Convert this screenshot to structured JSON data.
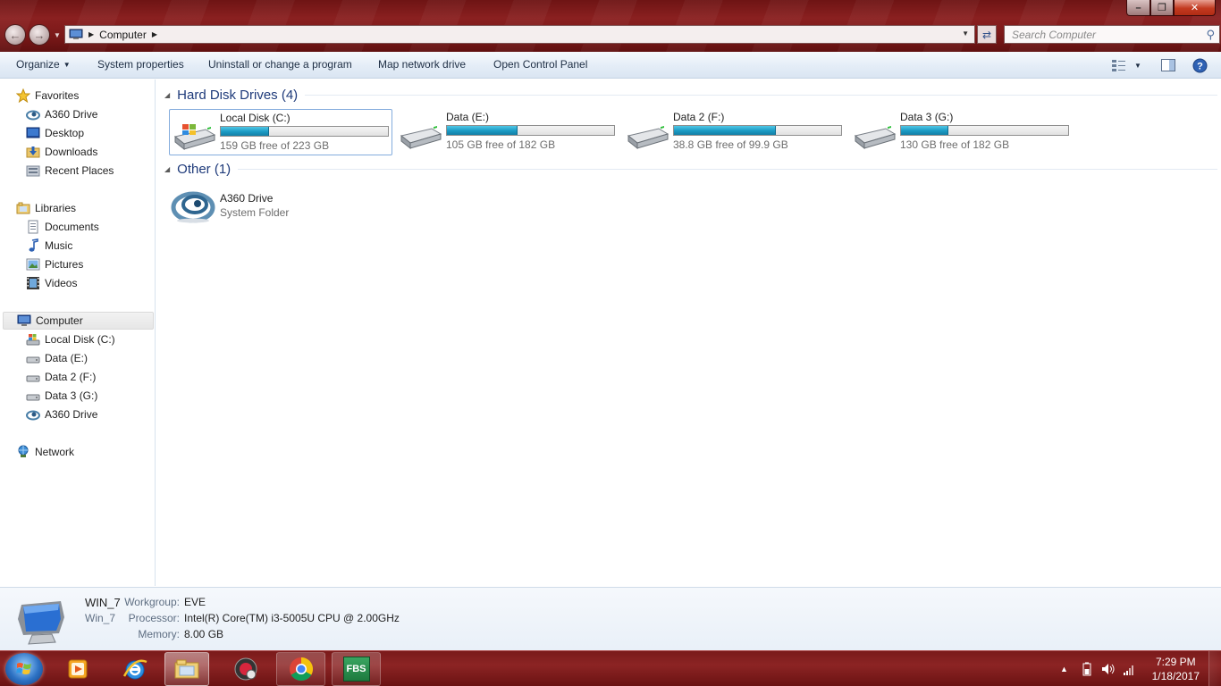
{
  "window": {
    "address": {
      "crumbs": [
        "Computer"
      ]
    },
    "search": {
      "placeholder": "Search Computer"
    }
  },
  "toolbar": {
    "organize": "Organize",
    "system_properties": "System properties",
    "uninstall": "Uninstall or change a program",
    "map_drive": "Map network drive",
    "control_panel": "Open Control Panel"
  },
  "sidebar": {
    "favorites": {
      "label": "Favorites",
      "items": [
        {
          "label": "A360 Drive",
          "icon": "a360-icon"
        },
        {
          "label": "Desktop",
          "icon": "desktop-icon"
        },
        {
          "label": "Downloads",
          "icon": "downloads-icon"
        },
        {
          "label": "Recent Places",
          "icon": "recent-places-icon"
        }
      ]
    },
    "libraries": {
      "label": "Libraries",
      "items": [
        {
          "label": "Documents",
          "icon": "documents-icon"
        },
        {
          "label": "Music",
          "icon": "music-icon"
        },
        {
          "label": "Pictures",
          "icon": "pictures-icon"
        },
        {
          "label": "Videos",
          "icon": "videos-icon"
        }
      ]
    },
    "computer": {
      "label": "Computer",
      "items": [
        {
          "label": "Local Disk (C:)",
          "icon": "windows-drive-icon"
        },
        {
          "label": "Data (E:)",
          "icon": "drive-icon"
        },
        {
          "label": "Data 2 (F:)",
          "icon": "drive-icon"
        },
        {
          "label": "Data 3 (G:)",
          "icon": "drive-icon"
        },
        {
          "label": "A360 Drive",
          "icon": "a360-icon"
        }
      ]
    },
    "network": {
      "label": "Network"
    }
  },
  "content": {
    "hard_disks": {
      "title": "Hard Disk Drives (4)",
      "drives": [
        {
          "name": "Local Disk (C:)",
          "free": "159 GB free of 223 GB",
          "used_fraction": 0.287,
          "system": true
        },
        {
          "name": "Data (E:)",
          "free": "105 GB free of 182 GB",
          "used_fraction": 0.423,
          "system": false
        },
        {
          "name": "Data 2 (F:)",
          "free": "38.8 GB free of 99.9 GB",
          "used_fraction": 0.612,
          "system": false
        },
        {
          "name": "Data 3 (G:)",
          "free": "130 GB free of 182 GB",
          "used_fraction": 0.286,
          "system": false
        }
      ]
    },
    "other": {
      "title": "Other (1)",
      "items": [
        {
          "name": "A360 Drive",
          "type": "System Folder"
        }
      ]
    }
  },
  "details": {
    "name": "WIN_7",
    "subname": "Win_7",
    "workgroup_label": "Workgroup:",
    "workgroup": "EVE",
    "processor_label": "Processor:",
    "processor": "Intel(R) Core(TM) i3-5005U CPU @ 2.00GHz",
    "memory_label": "Memory:",
    "memory": "8.00 GB"
  },
  "taskbar": {
    "pinned": [
      "media-player-icon",
      "internet-explorer-icon",
      "explorer-icon",
      "app-icon",
      "chrome-icon",
      "fbs-icon"
    ],
    "fbs_label": "FBS",
    "clock": {
      "time": "7:29 PM",
      "date": "1/18/2017"
    }
  },
  "colors": {
    "accent": "#1e3a7a",
    "titlebar": "#7a1818",
    "taskbar": "#8c2424",
    "bar_fill": "#1b9ac3"
  }
}
